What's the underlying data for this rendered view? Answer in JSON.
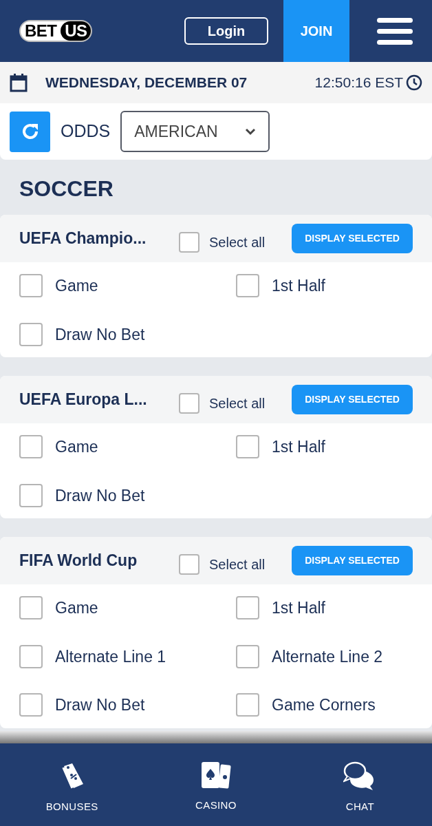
{
  "header": {
    "logo": [
      "BET",
      "US"
    ],
    "login": "Login",
    "join": "JOIN"
  },
  "date_bar": {
    "date": "WEDNESDAY, DECEMBER 07",
    "time": "12:50:16 EST"
  },
  "odds": {
    "label": "ODDS",
    "value": "AMERICAN"
  },
  "section_title": "SOCCER",
  "leagues": [
    {
      "title": "UEFA Champio...",
      "select_all": {
        "label": "Select all",
        "checked": false
      },
      "button": "DISPLAY SELECTED",
      "options": [
        {
          "label": "Game",
          "checked": false
        },
        {
          "label": "1st Half",
          "checked": false
        },
        {
          "label": "Draw No Bet",
          "checked": false
        }
      ]
    },
    {
      "title": "UEFA Europa L...",
      "select_all": {
        "label": "Select all",
        "checked": false
      },
      "button": "DISPLAY SELECTED",
      "options": [
        {
          "label": "Game",
          "checked": false
        },
        {
          "label": "1st Half",
          "checked": false
        },
        {
          "label": "Draw No Bet",
          "checked": false
        }
      ]
    },
    {
      "title": "FIFA World Cup",
      "select_all": {
        "label": "Select all",
        "checked": false
      },
      "button": "DISPLAY SELECTED",
      "options": [
        {
          "label": "Game",
          "checked": false
        },
        {
          "label": "1st Half",
          "checked": false
        },
        {
          "label": "Alternate Line 1",
          "checked": false
        },
        {
          "label": "Alternate Line 2",
          "checked": false
        },
        {
          "label": "Draw No Bet",
          "checked": false
        },
        {
          "label": "Game Corners",
          "checked": false
        }
      ]
    }
  ],
  "bottom_nav": [
    {
      "kind": "bonuses",
      "label": "BONUSES"
    },
    {
      "kind": "casino",
      "label": "CASINO"
    },
    {
      "kind": "chat",
      "label": "CHAT"
    }
  ]
}
